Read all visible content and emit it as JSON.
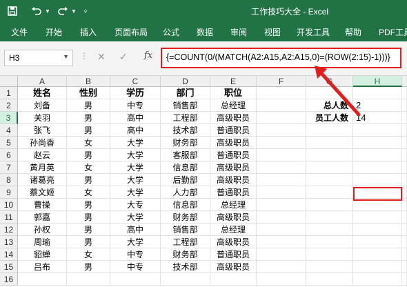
{
  "titlebar": {
    "title": "工作技巧大全 - Excel"
  },
  "ribbon": {
    "tabs": [
      "文件",
      "开始",
      "插入",
      "页面布局",
      "公式",
      "数据",
      "审阅",
      "视图",
      "开发工具",
      "帮助",
      "PDF工具"
    ]
  },
  "formula_bar": {
    "name_box": "H3",
    "fx_label": "fx",
    "formula": "{=COUNT(0/(MATCH(A2:A15,A2:A15,0)=(ROW(2:15)-1)))}"
  },
  "columns": [
    "A",
    "B",
    "C",
    "D",
    "E",
    "F",
    "G",
    "H"
  ],
  "rows": [
    "1",
    "2",
    "3",
    "4",
    "5",
    "6",
    "7",
    "8",
    "9",
    "10",
    "11",
    "12",
    "13",
    "14",
    "15",
    "16"
  ],
  "table": {
    "headers": [
      "姓名",
      "性别",
      "学历",
      "部门",
      "职位"
    ],
    "data": [
      [
        "刘备",
        "男",
        "中专",
        "销售部",
        "总经理"
      ],
      [
        "关羽",
        "男",
        "高中",
        "工程部",
        "高级职员"
      ],
      [
        "张飞",
        "男",
        "高中",
        "技术部",
        "普通职员"
      ],
      [
        "孙尚香",
        "女",
        "大学",
        "财务部",
        "高级职员"
      ],
      [
        "赵云",
        "男",
        "大学",
        "客服部",
        "普通职员"
      ],
      [
        "黄月英",
        "女",
        "大学",
        "信息部",
        "高级职员"
      ],
      [
        "诸葛亮",
        "男",
        "大学",
        "后勤部",
        "高级职员"
      ],
      [
        "蔡文姬",
        "女",
        "大学",
        "人力部",
        "普通职员"
      ],
      [
        "曹操",
        "男",
        "大专",
        "信息部",
        "总经理"
      ],
      [
        "郭嘉",
        "男",
        "大学",
        "财务部",
        "高级职员"
      ],
      [
        "孙权",
        "男",
        "高中",
        "销售部",
        "总经理"
      ],
      [
        "周瑜",
        "男",
        "大学",
        "工程部",
        "高级职员"
      ],
      [
        "貂蝉",
        "女",
        "中专",
        "财务部",
        "普通职员"
      ],
      [
        "吕布",
        "男",
        "中专",
        "技术部",
        "高级职员"
      ]
    ]
  },
  "summary": {
    "total_label": "总人数",
    "total_value": "2",
    "staff_label": "员工人数",
    "staff_value": "14"
  },
  "colors": {
    "excel_green": "#217346",
    "highlight_red": "#e21d1d"
  }
}
